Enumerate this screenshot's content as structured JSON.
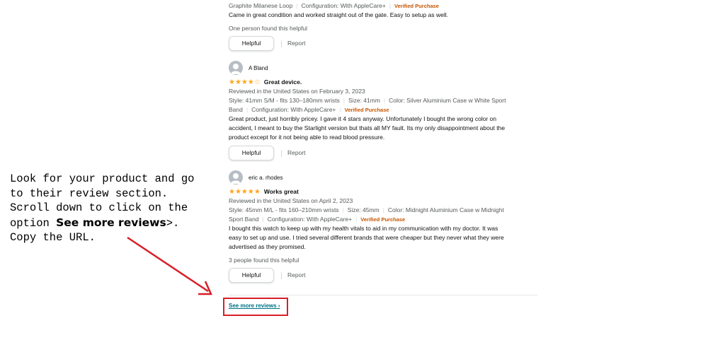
{
  "review_top": {
    "attrs_line": [
      "Graphite Milanese Loop",
      "Configuration: With AppleCare+"
    ],
    "verified": "Verified Purchase",
    "body": "Came in great condition and worked straight out of the gate. Easy to setup as well.",
    "helpful_count": "One person found this helpful",
    "helpful_label": "Helpful",
    "report_label": "Report"
  },
  "review_1": {
    "name": "A Bland",
    "rating": 4,
    "stars_text": "★★★★☆",
    "title": "Great device.",
    "date": "Reviewed in the United States on February 3, 2023",
    "style": "Style: 41mm S/M - fits 130–180mm wrists",
    "size": "Size: 41mm",
    "color": "Color: Silver Aluminium Case w White Sport",
    "band": "Band",
    "config": "Configuration: With AppleCare+",
    "verified": "Verified Purchase",
    "body_lines": [
      "Great product, just horribly pricey. I gave it 4 stars anyway. Unfortunately I bought the wrong color on",
      "accident, I meant to buy the Starlight version but thats all MY fault. Its my only disappointment about the",
      "product except for it not being able to read blood pressure."
    ],
    "helpful_label": "Helpful",
    "report_label": "Report"
  },
  "review_2": {
    "name": "eric a. rhodes",
    "rating": 5,
    "stars_text": "★★★★★",
    "title": "Works great",
    "date": "Reviewed in the United States on April 2, 2023",
    "style": "Style: 45mm M/L - fits 160–210mm wrists",
    "size": "Size: 45mm",
    "color": "Color: Midnight Aluminium Case w Midnight",
    "band": "Sport Band",
    "config": "Configuration: With AppleCare+",
    "verified": "Verified Purchase",
    "body_lines": [
      "I bought this watch to keep up with my health vitals to aid in my communication with my doctor. It was",
      "easy to set up and use. I tried several different brands that were cheaper but they never what they were",
      "advertised as they promised."
    ],
    "helpful_count": "3 people found this helpful",
    "helpful_label": "Helpful",
    "report_label": "Report"
  },
  "see_more": "See more reviews ›",
  "instructions": {
    "line1": "Look for your product and go",
    "line2": "to their review section.",
    "line3": "Scroll down to click on the",
    "line4_prefix": "option ",
    "line4_bold": "See more reviews",
    "line4_suffix": ">.",
    "line5": "Copy the URL."
  },
  "colors": {
    "annotation_red": "#d81f26",
    "star": "#ffa41c",
    "link": "#007185",
    "verified": "#c45500"
  }
}
